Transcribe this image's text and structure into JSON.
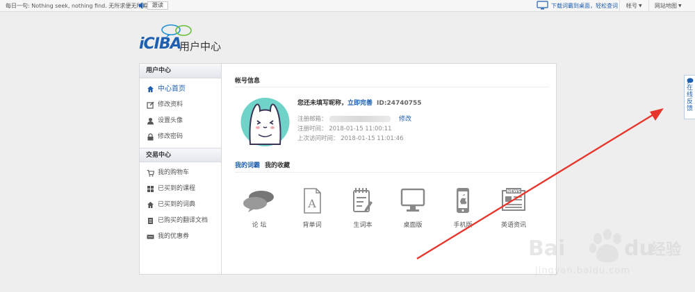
{
  "topbar": {
    "daily_sentence": "每日一句: Nothing seek, nothing find. 无所求便无所得",
    "follow_label": "跟读",
    "download_text": "下载词霸到桌面，轻松查词",
    "account_label": "帐号",
    "sitemap_label": "网站地图",
    "icons": [
      "speaker-icon",
      "monitor-icon"
    ]
  },
  "logo": {
    "brand": "iCIBA",
    "subtitle": "用户中心"
  },
  "sidebar": {
    "user_center_title": "用户中心",
    "user_items": [
      {
        "label": "中心首页",
        "icon": "home-icon"
      },
      {
        "label": "修改资料",
        "icon": "edit-icon"
      },
      {
        "label": "设置头像",
        "icon": "person-icon"
      },
      {
        "label": "修改密码",
        "icon": "lock-icon"
      }
    ],
    "trade_center_title": "交易中心",
    "trade_items": [
      {
        "label": "我的购物车",
        "icon": "cart-icon"
      },
      {
        "label": "已买到的课程",
        "icon": "grid-icon"
      },
      {
        "label": "已买到的词典",
        "icon": "home-icon"
      },
      {
        "label": "已购买的翻译文档",
        "icon": "document-icon"
      },
      {
        "label": "我的优惠券",
        "icon": "coupon-icon"
      }
    ]
  },
  "account": {
    "section_title": "帐号信息",
    "nickname_text": "您还未填写昵称，",
    "complete_link": "立即完善",
    "user_id": "ID:24740755",
    "email_label": "注册邮箱：",
    "edit_link": "修改",
    "register_time": "注册时间： 2018-01-15 11:00:11",
    "last_visit": "上次访问时间： 2018-01-15 11:01:46"
  },
  "tabs": {
    "my_words": "我的词霸",
    "my_favorites": "我的收藏"
  },
  "tiles": [
    {
      "label": "论 坛",
      "icon": "forum-icon"
    },
    {
      "label": "背单词",
      "icon": "word-card-icon"
    },
    {
      "label": "生词本",
      "icon": "notebook-icon"
    },
    {
      "label": "桌面版",
      "icon": "desktop-icon"
    },
    {
      "label": "手机版",
      "icon": "phone-icon"
    },
    {
      "label": "英语资讯",
      "icon": "news-icon"
    }
  ],
  "feedback": {
    "chars": [
      "在",
      "线",
      "反",
      "馈"
    ]
  },
  "watermark": {
    "brand": "Bai",
    "brand_suffix": "du",
    "cn": "经验",
    "url": "jingyan.baidu.com"
  },
  "colors": {
    "accent": "#1f5fb0",
    "arrow": "#e8352b",
    "avatar_bg": "#6fd3c9"
  }
}
